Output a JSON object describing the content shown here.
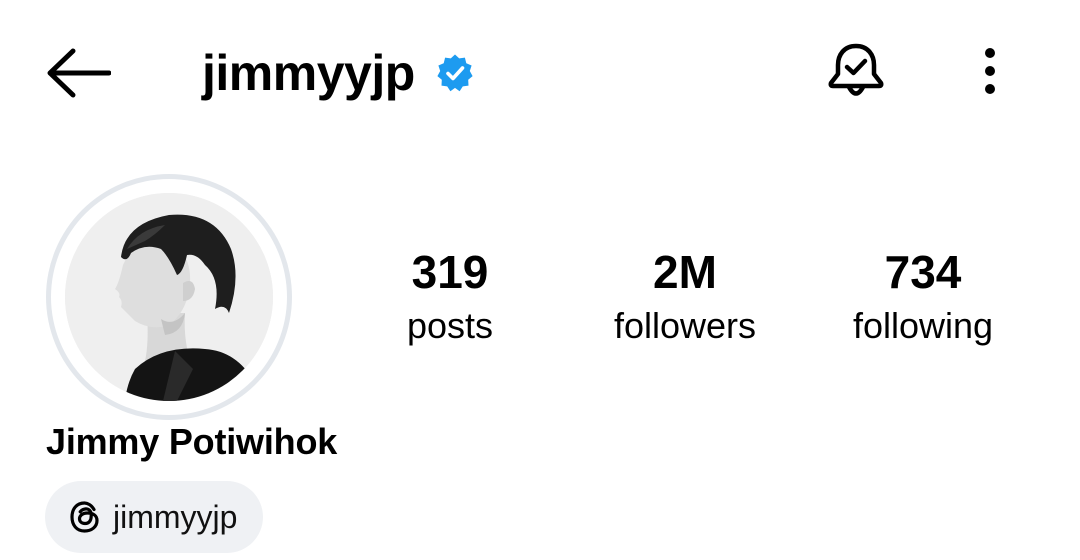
{
  "header": {
    "username": "jimmyyjp",
    "back_icon": "arrow-left-icon",
    "verified_icon": "verified-badge-icon",
    "bell_icon": "notification-bell-check-icon",
    "more_icon": "more-vertical-icon"
  },
  "colors": {
    "verified": "#1d9bf0",
    "avatar_ring": "#e3e7ec",
    "pill_bg": "#eff1f4"
  },
  "stats": {
    "posts": {
      "value": "319",
      "label": "posts"
    },
    "followers": {
      "value": "2M",
      "label": "followers"
    },
    "following": {
      "value": "734",
      "label": "following"
    }
  },
  "profile": {
    "display_name": "Jimmy Potiwihok",
    "threads_icon": "threads-icon",
    "threads_handle": "jimmyyjp"
  }
}
